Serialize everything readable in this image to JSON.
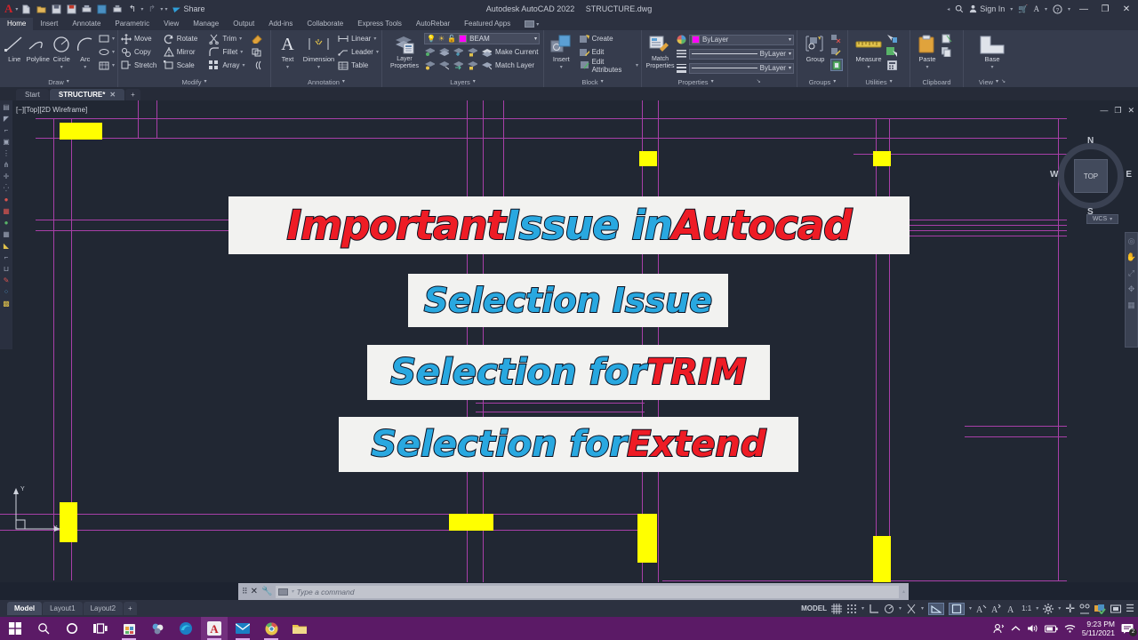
{
  "titlebar": {
    "app_title": "Autodesk AutoCAD 2022",
    "file_name": "STRUCTURE.dwg",
    "share_label": "Share",
    "sign_in": "Sign In",
    "qat_icons": [
      "new-icon",
      "open-icon",
      "save-icon",
      "saveas-icon",
      "plot-icon",
      "cloud-icon",
      "print-icon",
      "undo-icon",
      "redo-icon"
    ],
    "window_buttons": {
      "minimize": "—",
      "restore": "❐",
      "close": "✕"
    }
  },
  "ribbon_tabs": [
    {
      "label": "Home",
      "active": true
    },
    {
      "label": "Insert",
      "active": false
    },
    {
      "label": "Annotate",
      "active": false
    },
    {
      "label": "Parametric",
      "active": false
    },
    {
      "label": "View",
      "active": false
    },
    {
      "label": "Manage",
      "active": false
    },
    {
      "label": "Output",
      "active": false
    },
    {
      "label": "Add-ins",
      "active": false
    },
    {
      "label": "Collaborate",
      "active": false
    },
    {
      "label": "Express Tools",
      "active": false
    },
    {
      "label": "AutoRebar",
      "active": false
    },
    {
      "label": "Featured Apps",
      "active": false
    }
  ],
  "panels": {
    "draw": {
      "title": "Draw",
      "big": [
        {
          "label": "Line",
          "icon": "line-icon"
        },
        {
          "label": "Polyline",
          "icon": "polyline-icon"
        },
        {
          "label": "Circle",
          "icon": "circle-icon"
        },
        {
          "label": "Arc",
          "icon": "arc-icon"
        }
      ],
      "small_icons": [
        "rectangle-icon",
        "ellipse-icon",
        "hatch-icon"
      ]
    },
    "modify": {
      "title": "Modify",
      "items": [
        {
          "label": "Move",
          "icon": "move-icon"
        },
        {
          "label": "Rotate",
          "icon": "rotate-icon"
        },
        {
          "label": "Trim",
          "icon": "trim-icon"
        },
        {
          "label": "Copy",
          "icon": "copy-icon"
        },
        {
          "label": "Mirror",
          "icon": "mirror-icon"
        },
        {
          "label": "Fillet",
          "icon": "fillet-icon"
        },
        {
          "label": "Stretch",
          "icon": "stretch-icon"
        },
        {
          "label": "Scale",
          "icon": "scale-icon"
        },
        {
          "label": "Array",
          "icon": "array-icon"
        }
      ],
      "extra_icons": [
        "erase-icon",
        "explode-icon",
        "offset-icon"
      ]
    },
    "annotation": {
      "title": "Annotation",
      "big": [
        {
          "label": "Text",
          "icon": "text-icon"
        },
        {
          "label": "Dimension",
          "icon": "dimension-icon"
        }
      ],
      "items": [
        {
          "label": "Linear",
          "icon": "linear-dim-icon"
        },
        {
          "label": "Leader",
          "icon": "leader-icon"
        },
        {
          "label": "Table",
          "icon": "table-icon"
        }
      ]
    },
    "layers": {
      "title": "Layers",
      "big": {
        "label": "Layer\nProperties",
        "icon": "layer-properties-icon"
      },
      "current_layer": "BEAM",
      "layer_color": "#ff00ff",
      "items": [
        {
          "label": "Make Current",
          "icon": "make-current-icon"
        },
        {
          "label": "Match Layer",
          "icon": "match-layer-icon"
        }
      ]
    },
    "block": {
      "title": "Block",
      "big": {
        "label": "Insert",
        "icon": "insert-block-icon"
      },
      "items": [
        {
          "label": "Create",
          "icon": "create-block-icon"
        },
        {
          "label": "Edit",
          "icon": "edit-block-icon"
        },
        {
          "label": "Edit Attributes",
          "icon": "edit-attributes-icon"
        }
      ]
    },
    "properties": {
      "title": "Properties",
      "big": {
        "label": "Match\nProperties",
        "icon": "match-properties-icon"
      },
      "combos": [
        {
          "value": "ByLayer",
          "type": "color",
          "swatch": "#ff00ff"
        },
        {
          "value": "ByLayer",
          "type": "linetype"
        },
        {
          "value": "ByLayer",
          "type": "lineweight"
        }
      ]
    },
    "groups": {
      "title": "Groups",
      "big": {
        "label": "Group",
        "icon": "group-icon"
      }
    },
    "utilities": {
      "title": "Utilities",
      "big": {
        "label": "Measure",
        "icon": "measure-icon"
      },
      "small_icons": [
        "id-point-icon",
        "quick-select-icon",
        "calculator-icon"
      ]
    },
    "clipboard": {
      "title": "Clipboard",
      "big": {
        "label": "Paste",
        "icon": "paste-icon"
      },
      "small_icons": [
        "cut-icon",
        "copy-clip-icon"
      ]
    },
    "view": {
      "title": "View",
      "big": {
        "label": "Base",
        "icon": "base-view-icon"
      }
    }
  },
  "doc_tabs": [
    {
      "label": "Start",
      "active": false
    },
    {
      "label": "STRUCTURE*",
      "active": true
    }
  ],
  "doc_tab_add": "+",
  "canvas": {
    "viewport_label": "[−][Top][2D Wireframe]",
    "viewcube": {
      "top": "TOP",
      "n": "N",
      "s": "S",
      "e": "E",
      "w": "W",
      "wcs": "WCS"
    },
    "ucs_labels": {
      "y": "Y",
      "x": "X"
    },
    "line_color": "#a83fa8",
    "highlight_color": "#ffff00",
    "background": "#212733"
  },
  "overlays": [
    {
      "id": "title-overlay",
      "parts": [
        {
          "text": "Important ",
          "color": "red"
        },
        {
          "text": "Issue in ",
          "color": "blue"
        },
        {
          "text": "Autocad",
          "color": "red"
        }
      ]
    },
    {
      "id": "selection-issue-overlay",
      "parts": [
        {
          "text": "Selection Issue",
          "color": "blue"
        }
      ]
    },
    {
      "id": "selection-trim-overlay",
      "parts": [
        {
          "text": "Selection for ",
          "color": "blue"
        },
        {
          "text": "TRIM",
          "color": "red"
        }
      ]
    },
    {
      "id": "selection-extend-overlay",
      "parts": [
        {
          "text": "Selection for ",
          "color": "blue"
        },
        {
          "text": "Extend",
          "color": "red"
        }
      ]
    }
  ],
  "command_line": {
    "placeholder": "Type a command",
    "value": ""
  },
  "layout_tabs": [
    {
      "label": "Model",
      "active": true
    },
    {
      "label": "Layout1",
      "active": false
    },
    {
      "label": "Layout2",
      "active": false
    },
    {
      "label": "+",
      "active": false
    }
  ],
  "status_bar": {
    "space": "MODEL",
    "scale": "1:1",
    "toggles": [
      "grid-icon",
      "snap-icon",
      "ortho-icon",
      "polar-icon",
      "osnap-icon",
      "otrack-icon",
      "lineweight-icon",
      "transparency-icon",
      "selection-cycling-icon",
      "annotation-visibility-icon",
      "autoscale-icon",
      "annotation-scale-icon",
      "workspace-icon",
      "hardware-accel-icon",
      "isolate-objects-icon",
      "clean-screen-icon",
      "customization-icon"
    ]
  },
  "taskbar": {
    "icons": [
      "start-icon",
      "search-icon",
      "cortana-icon",
      "task-view-icon",
      "store-icon",
      "photos-icon",
      "edge-icon",
      "autocad-icon",
      "mail-icon",
      "chrome-icon",
      "explorer-icon"
    ],
    "tray_icons": [
      "people-icon",
      "show-hidden-icon",
      "volume-icon",
      "battery-icon",
      "wifi-icon"
    ],
    "time": "9:23 PM",
    "date": "5/11/2021",
    "notification_count": "2"
  }
}
